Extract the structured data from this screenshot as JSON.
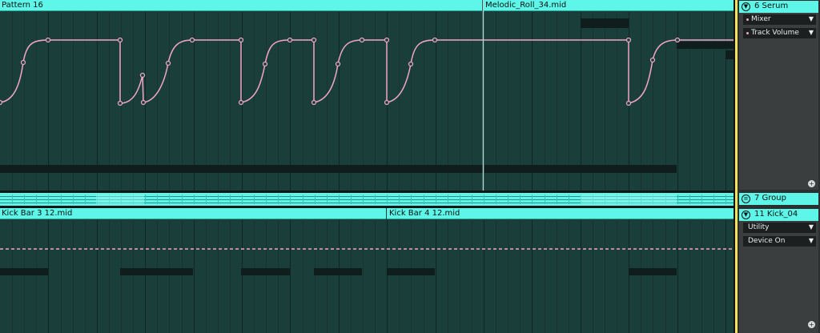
{
  "clips": {
    "pattern_16": "Pattern 16",
    "melodic_roll": "Melodic_Roll_34.mid",
    "kick_bar_3": "Kick  Bar  3  12.mid",
    "kick_bar_4": "Kick  Bar  4  12.mid"
  },
  "tracks": {
    "serum": {
      "icon": "chevron-down-icon",
      "name": "6 Serum",
      "device_chooser": "Mixer",
      "control_chooser": "Track Volume"
    },
    "group": {
      "icon": "group-icon",
      "name": "7 Group"
    },
    "kick": {
      "icon": "chevron-down-icon",
      "name": "11 Kick_04",
      "device_chooser": "Utility",
      "control_chooser": "Device On"
    }
  },
  "colors": {
    "clip_header": "#5ef6e8",
    "lane_background": "#1a3f3a",
    "automation_line": "#f4a6c9",
    "note_bar": "#0f1e1c",
    "selected_track_accent": "#f5e15a",
    "panel_background": "#2b2f2f"
  }
}
